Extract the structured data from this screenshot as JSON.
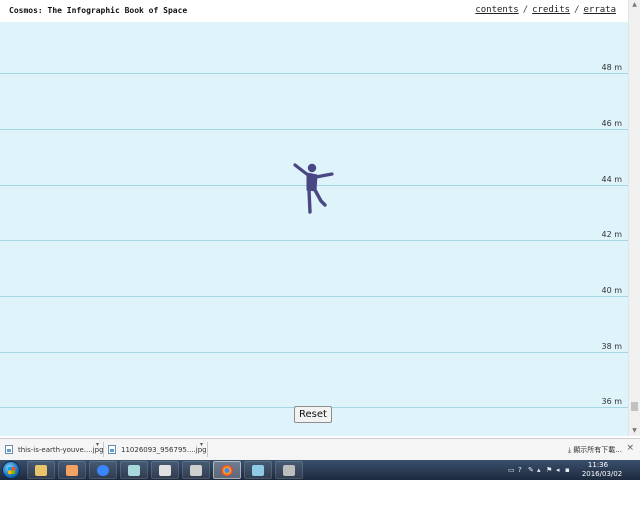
{
  "header": {
    "title": "Cosmos: The Infographic Book of Space",
    "nav": [
      {
        "label": "contents"
      },
      {
        "label": "credits"
      },
      {
        "label": "errata"
      }
    ],
    "separator": "/"
  },
  "altitude": {
    "unit": "m",
    "labels": [
      "48 m",
      "46 m",
      "44 m",
      "42 m",
      "40 m",
      "38 m",
      "36 m"
    ]
  },
  "controls": {
    "reset_label": "Reset"
  },
  "downloads": {
    "items": [
      {
        "filename": "this-is-earth-youve....jpg"
      },
      {
        "filename": "11026093_956795....jpg"
      }
    ],
    "show_all_label": "顯示所有下載...",
    "close_glyph": "×"
  },
  "taskbar": {
    "time": "11:36",
    "date": "2016/03/02",
    "apps": [
      {
        "name": "explorer-icon",
        "color": "#e9c46a"
      },
      {
        "name": "media-player-icon",
        "color": "#f4a261"
      },
      {
        "name": "internet-explorer-icon",
        "color": "#3a86ff"
      },
      {
        "name": "notes-icon",
        "color": "#a8dadc"
      },
      {
        "name": "document-icon",
        "color": "#e0e0e0"
      },
      {
        "name": "camera-icon",
        "color": "#cfcfcf"
      },
      {
        "name": "chrome-icon",
        "color": "#e63946"
      },
      {
        "name": "photo-viewer-icon",
        "color": "#8ecae6"
      },
      {
        "name": "film-app-icon",
        "color": "#bdbdbd"
      }
    ]
  },
  "colors": {
    "sky": "#dff3fb",
    "gridline": "#a8d7e4",
    "figure": "#4a4785"
  }
}
